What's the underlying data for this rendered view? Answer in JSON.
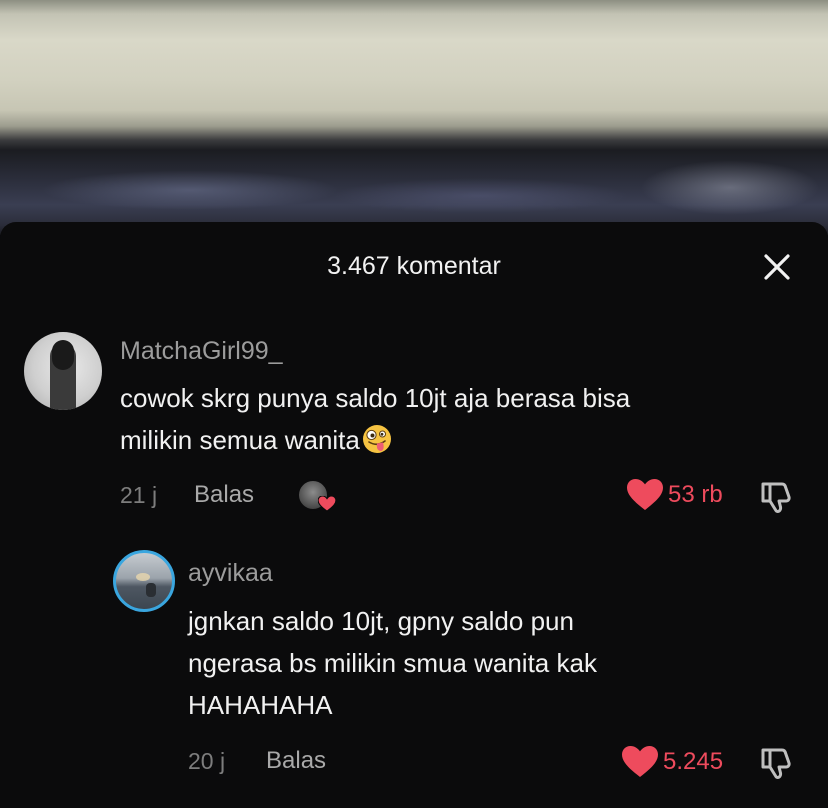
{
  "sheet": {
    "title": "3.467 komentar",
    "close_icon": "close-icon"
  },
  "comments": [
    {
      "username": "MatchaGirl99_",
      "text_line1": "cowok skrg punya saldo 10jt aja berasa bisa",
      "text_line2": "milikin semua wanita",
      "emoji": "zany-face-emoji",
      "time": "21 j",
      "reply_label": "Balas",
      "creator_liked": true,
      "likes": "53 rb",
      "like_color": "#ee4b5d",
      "avatar_ring": "none"
    },
    {
      "username": "ayvikaa",
      "text_line1": "jgnkan saldo 10jt, gpny saldo pun",
      "text_line2": "ngerasa bs milikin smua wanita kak",
      "text_line3": "HAHAHAHA",
      "time": "20 j",
      "reply_label": "Balas",
      "likes": "5.245",
      "like_color": "#ee4b5d",
      "avatar_ring": "#3aa6df"
    }
  ]
}
